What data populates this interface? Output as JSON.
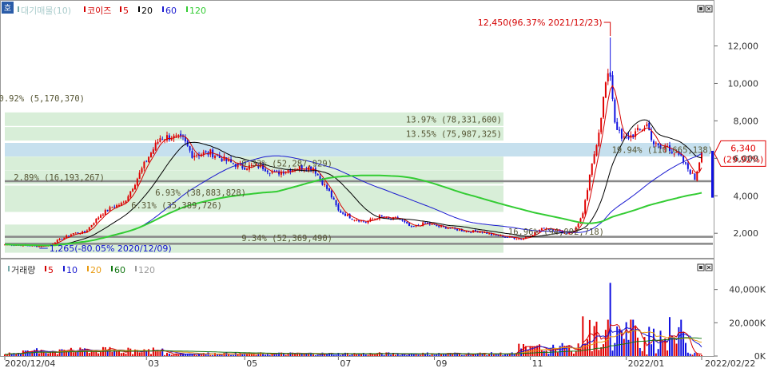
{
  "chart_data": [
    {
      "type": "candlestick",
      "id": "price",
      "legend": {
        "icon": "ho-badge",
        "main": "대기매물(10)",
        "series": "코이즈",
        "ma_labels": [
          "5",
          "20",
          "60",
          "120"
        ],
        "ma_colors": [
          "#d40000",
          "#000000",
          "#1a1ad0",
          "#33cc33"
        ]
      },
      "ylim": [
        900,
        13600
      ],
      "y_ticks": [
        2000,
        4000,
        6000,
        8000,
        10000,
        12000
      ],
      "y_tick_labels": [
        "2,000",
        "4,000",
        "6,000",
        "8,000",
        "10,000",
        "12,000"
      ],
      "x_ticks": [
        {
          "label": "2020/12/04",
          "index": 0
        },
        {
          "label": "03",
          "index": 62
        },
        {
          "label": "05",
          "index": 105
        },
        {
          "label": "07",
          "index": 146
        },
        {
          "label": "09",
          "index": 188
        },
        {
          "label": "11",
          "index": 230
        },
        {
          "label": "2022/01",
          "index": 272
        },
        {
          "label": "2022/02/22",
          "index": 305
        }
      ],
      "n_bars": 306,
      "anchors": [
        [
          0,
          1400
        ],
        [
          10,
          1350
        ],
        [
          15,
          1300
        ],
        [
          20,
          1380
        ],
        [
          22,
          1550
        ],
        [
          30,
          2000
        ],
        [
          35,
          2050
        ],
        [
          42,
          3000
        ],
        [
          47,
          3400
        ],
        [
          52,
          3600
        ],
        [
          57,
          4700
        ],
        [
          62,
          5900
        ],
        [
          68,
          7100
        ],
        [
          72,
          7150
        ],
        [
          78,
          7000
        ],
        [
          82,
          6200
        ],
        [
          90,
          6300
        ],
        [
          98,
          5800
        ],
        [
          104,
          5550
        ],
        [
          112,
          5600
        ],
        [
          118,
          5200
        ],
        [
          128,
          5500
        ],
        [
          135,
          5500
        ],
        [
          138,
          4900
        ],
        [
          142,
          4200
        ],
        [
          146,
          3200
        ],
        [
          152,
          2800
        ],
        [
          158,
          2600
        ],
        [
          164,
          2900
        ],
        [
          168,
          2750
        ],
        [
          172,
          2800
        ],
        [
          178,
          2300
        ],
        [
          184,
          2550
        ],
        [
          190,
          2350
        ],
        [
          196,
          2250
        ],
        [
          202,
          2100
        ],
        [
          208,
          2100
        ],
        [
          214,
          1900
        ],
        [
          220,
          1800
        ],
        [
          226,
          1700
        ],
        [
          230,
          1900
        ],
        [
          236,
          2300
        ],
        [
          241,
          2200
        ],
        [
          245,
          2000
        ],
        [
          249,
          2100
        ],
        [
          253,
          3000
        ],
        [
          256,
          5000
        ],
        [
          260,
          7500
        ],
        [
          263,
          10000
        ],
        [
          265,
          10500
        ],
        [
          267,
          8000
        ],
        [
          270,
          7000
        ],
        [
          274,
          7200
        ],
        [
          278,
          7500
        ],
        [
          281,
          7800
        ],
        [
          284,
          6800
        ],
        [
          287,
          6500
        ],
        [
          290,
          6700
        ],
        [
          293,
          6300
        ],
        [
          296,
          6000
        ],
        [
          298,
          5600
        ],
        [
          300,
          5300
        ],
        [
          302,
          4900
        ],
        [
          305,
          6340
        ]
      ],
      "max_point": {
        "index": 265,
        "value": 12450,
        "label": "12,450(96.37% 2021/12/23)"
      },
      "min_point": {
        "index": 16,
        "value": 1265,
        "label": "1,265(-80.05% 2020/12/09)"
      },
      "current": {
        "value": 6340,
        "label": "6,340",
        "change": "(29.92%)"
      },
      "supply_zones": [
        {
          "price": 1320,
          "label": "",
          "color": "#d8eed8"
        },
        {
          "price": 1750,
          "label": "9.34% (52,369,490)",
          "color": "#d8eed8"
        },
        {
          "price": 2100,
          "label": "16.96% (94,092,718)",
          "color": "#d8eed8"
        },
        {
          "price": 3500,
          "label": "6.31% (35,389,726)",
          "color": "#d8eed8"
        },
        {
          "price": 4180,
          "label": "6.93% (38,883,828)",
          "color": "#d8eed8"
        },
        {
          "price": 4990,
          "label": "2.89% (16,193,267)",
          "color": "#d8eed8"
        },
        {
          "price": 5730,
          "label": "9.33% (52,287,929)",
          "color": "#d8eed8"
        },
        {
          "price": 6460,
          "label": "19.94% (110,665,138)",
          "color": "#c6e0ee"
        },
        {
          "price": 7310,
          "label": "13.55% (75,987,325)",
          "color": "#d8eed8"
        },
        {
          "price": 8090,
          "label": "13.97% (78,331,600)",
          "color": "#d8eed8"
        },
        {
          "price": 9200,
          "label": "0.92% (5,170,370)",
          "color": "#ffffff"
        }
      ],
      "horizontal_lines": [
        4780,
        1810,
        1440
      ]
    },
    {
      "type": "bar",
      "id": "volume",
      "legend": {
        "main": "거래량",
        "ma_labels": [
          "5",
          "10",
          "20",
          "60",
          "120"
        ],
        "ma_colors": [
          "#d40000",
          "#1a1ad0",
          "#e89a10",
          "#117711",
          "#999999"
        ]
      },
      "ylim": [
        0,
        48000
      ],
      "y_ticks": [
        0,
        20000,
        40000
      ],
      "y_tick_labels": [
        "0K",
        "20,000K",
        "40,000K"
      ],
      "max_value": 44000
    }
  ]
}
